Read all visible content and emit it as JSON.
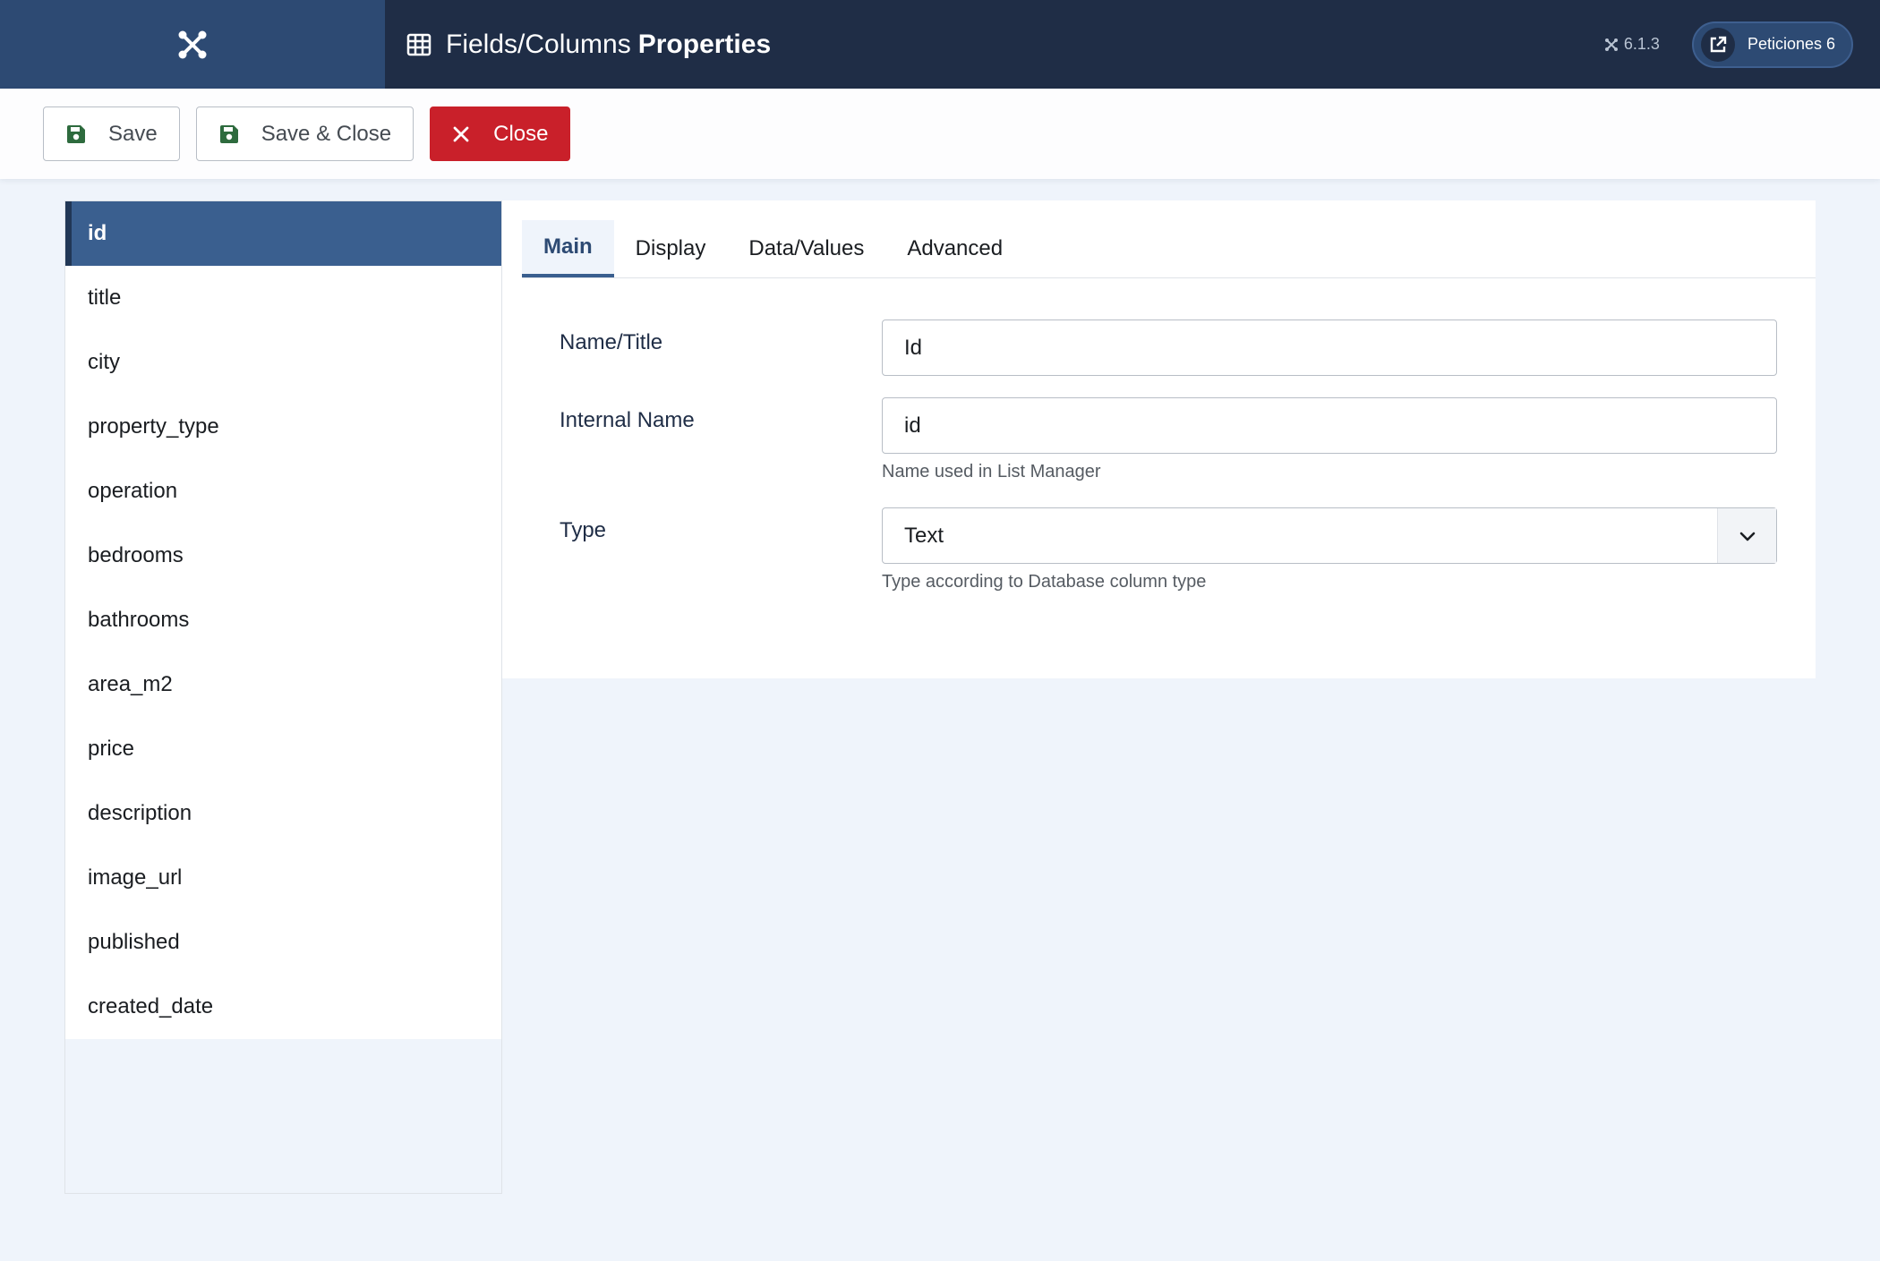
{
  "header": {
    "title_prefix": "Fields/Columns",
    "title_strong": "Properties",
    "version": "6.1.3",
    "requests_button": "Peticiones 6"
  },
  "toolbar": {
    "save_label": "Save",
    "save_close_label": "Save & Close",
    "close_label": "Close"
  },
  "sidebar": {
    "items": [
      {
        "label": "id"
      },
      {
        "label": "title"
      },
      {
        "label": "city"
      },
      {
        "label": "property_type"
      },
      {
        "label": "operation"
      },
      {
        "label": "bedrooms"
      },
      {
        "label": "bathrooms"
      },
      {
        "label": "area_m2"
      },
      {
        "label": "price"
      },
      {
        "label": "description"
      },
      {
        "label": "image_url"
      },
      {
        "label": "published"
      },
      {
        "label": "created_date"
      }
    ],
    "active_index": 0
  },
  "tabs": [
    {
      "label": "Main"
    },
    {
      "label": "Display"
    },
    {
      "label": "Data/Values"
    },
    {
      "label": "Advanced"
    }
  ],
  "form": {
    "name_title": {
      "label": "Name/Title",
      "value": "Id"
    },
    "internal_name": {
      "label": "Internal Name",
      "value": "id",
      "help": "Name used in List Manager"
    },
    "type": {
      "label": "Type",
      "value": "Text",
      "help": "Type according to Database column type"
    }
  },
  "colors": {
    "header_bg": "#1f2d46",
    "logo_bg": "#2d4a73",
    "accent": "#3a5f8f",
    "close_red": "#c9202a",
    "save_icon_green": "#2e6b3e"
  },
  "icons": {
    "logo": "joomla-logo-icon",
    "title": "table-grid-icon",
    "version": "joomla-small-icon",
    "requests": "external-link-icon",
    "save": "floppy-disk-icon",
    "close": "close-x-icon",
    "select": "chevron-down-icon"
  }
}
